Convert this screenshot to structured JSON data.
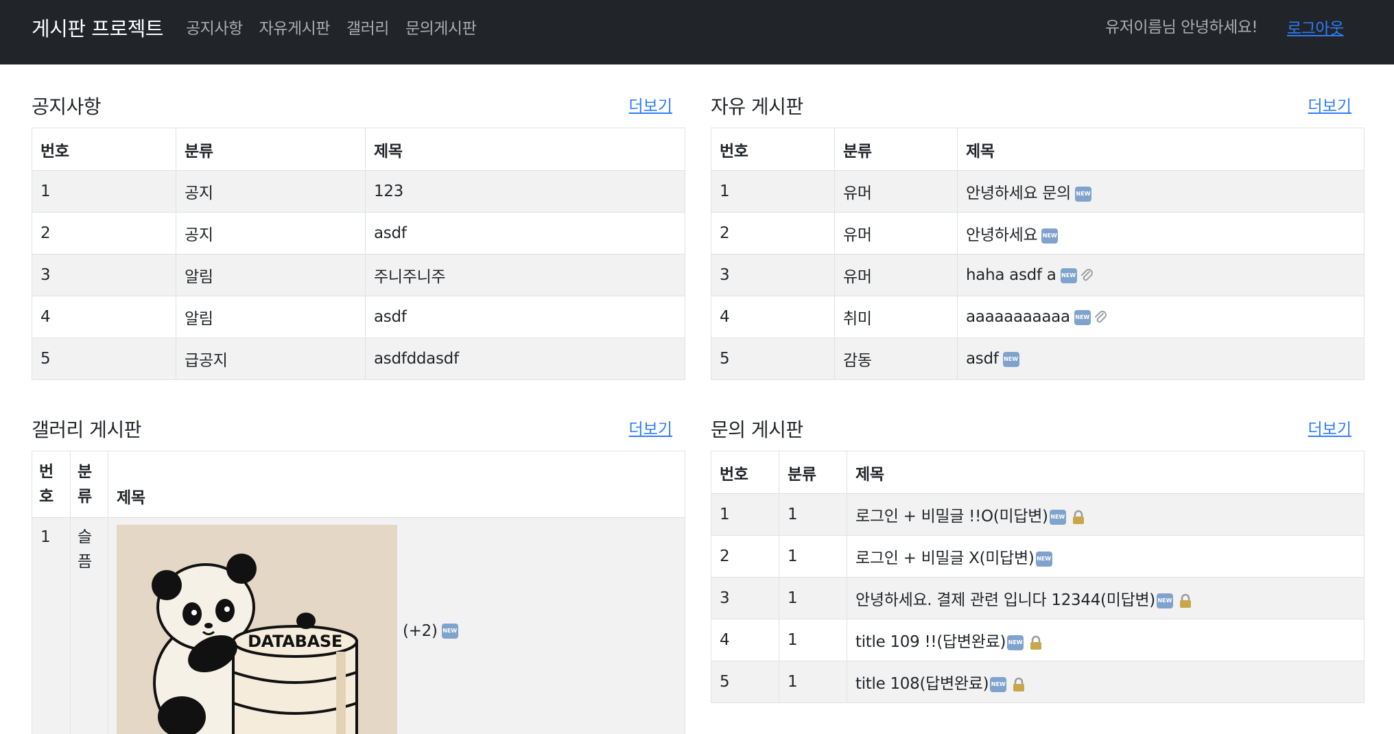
{
  "brand": "게시판 프로젝트",
  "nav": [
    "공지사항",
    "자유게시판",
    "갤러리",
    "문의게시판"
  ],
  "greeting": "유저이름님 안녕하세요!",
  "logout": "로그아웃",
  "more_label": "더보기",
  "columns": {
    "no": "번호",
    "category": "분류",
    "title": "제목"
  },
  "notice": {
    "title": "공지사항",
    "rows": [
      {
        "no": "1",
        "category": "공지",
        "title": "123"
      },
      {
        "no": "2",
        "category": "공지",
        "title": "asdf"
      },
      {
        "no": "3",
        "category": "알림",
        "title": "주니주니주"
      },
      {
        "no": "4",
        "category": "알림",
        "title": "asdf"
      },
      {
        "no": "5",
        "category": "급공지",
        "title": "asdfddasdf"
      }
    ]
  },
  "free": {
    "title": "자유 게시판",
    "rows": [
      {
        "no": "1",
        "category": "유머",
        "title": "안녕하세요 문의",
        "icons": [
          "new-icon"
        ]
      },
      {
        "no": "2",
        "category": "유머",
        "title": "안녕하세요",
        "icons": [
          "new-icon"
        ]
      },
      {
        "no": "3",
        "category": "유머",
        "title": "haha asdf a",
        "icons": [
          "new-icon",
          "paperclip-icon"
        ]
      },
      {
        "no": "4",
        "category": "취미",
        "title": "aaaaaaaaaaa",
        "icons": [
          "new-icon",
          "paperclip-icon"
        ]
      },
      {
        "no": "5",
        "category": "감동",
        "title": "asdf",
        "icons": [
          "new-icon"
        ]
      }
    ]
  },
  "gallery": {
    "title": "갤러리 게시판",
    "rows": [
      {
        "no": "1",
        "category": "슬픔",
        "image_text": "DATABASE",
        "extra": "(+2)",
        "icons": [
          "new-icon"
        ]
      }
    ]
  },
  "inquiry": {
    "title": "문의 게시판",
    "rows": [
      {
        "no": "1",
        "category": "1",
        "title": "로그인 + 비밀글 !!O(미답변)",
        "icons": [
          "new-icon",
          "lock-icon"
        ]
      },
      {
        "no": "2",
        "category": "1",
        "title": "로그인 + 비밀글 X(미답변)",
        "icons": [
          "new-icon"
        ]
      },
      {
        "no": "3",
        "category": "1",
        "title": "안녕하세요. 결제 관련 입니다 12344(미답변)",
        "icons": [
          "new-icon",
          "lock-icon"
        ]
      },
      {
        "no": "4",
        "category": "1",
        "title": "title 109 !!(답변완료)",
        "icons": [
          "new-icon",
          "lock-icon"
        ]
      },
      {
        "no": "5",
        "category": "1",
        "title": "title 108(답변완료)",
        "icons": [
          "new-icon",
          "lock-icon"
        ]
      }
    ]
  },
  "colors": {
    "navbar": "#212529",
    "link": "#2f7cf6",
    "stripe": "#f2f2f2",
    "border": "#dee2e6",
    "new_badge": "#7fa3cc"
  }
}
